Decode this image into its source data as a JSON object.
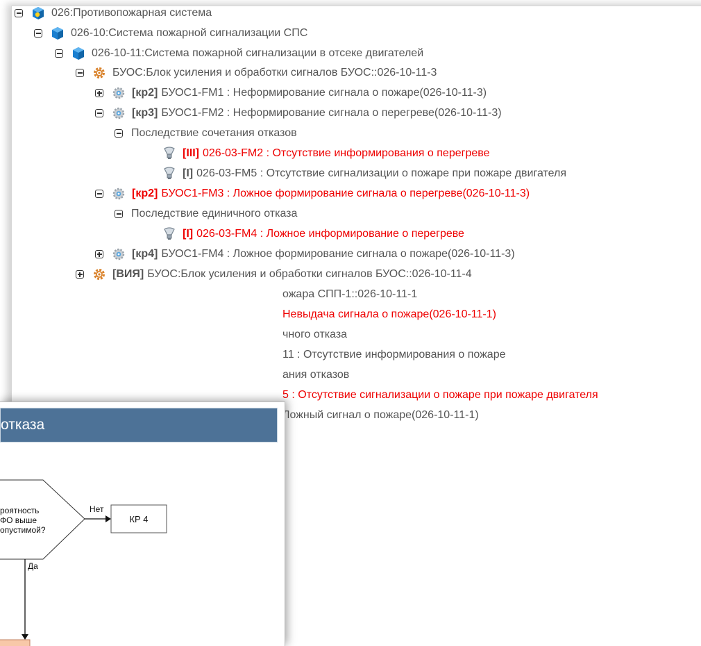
{
  "tree": {
    "rows": [
      {
        "toggle": "minus",
        "icon": "cube-yellow-icon",
        "text": "026:Противопожарная система",
        "text_class": "gray"
      },
      {
        "toggle": "minus",
        "icon": "cube-blue-icon",
        "text": "026-10:Система пожарной сигнализации СПС",
        "text_class": "gray"
      },
      {
        "toggle": "minus",
        "icon": "cube-blue-icon",
        "text": "026-10-11:Система пожарной сигнализации в отсеке двигателей",
        "text_class": "gray"
      },
      {
        "toggle": "minus",
        "icon": "gear-orange-icon",
        "text": "БУОС:Блок усиления и обработки сигналов БУОС::026-10-11-3",
        "text_class": "gray"
      },
      {
        "toggle": "plus",
        "icon": "gear-gray-icon",
        "code": "[кр2]",
        "code_class": "gray",
        "text": "БУОС1-FM1 : Неформирование сигнала о пожаре(026-10-11-3)",
        "text_class": "gray"
      },
      {
        "toggle": "minus",
        "icon": "gear-gray-icon",
        "code": "[кр3]",
        "code_class": "gray",
        "text": "БУОС1-FM2 : Неформирование сигнала о перегреве(026-10-11-3)",
        "text_class": "gray"
      },
      {
        "toggle": "minus",
        "text": "Последствие сочетания отказов",
        "text_class": "gray"
      },
      {
        "icon": "bulb-icon",
        "code": "[III]",
        "code_class": "red",
        "text": "026-03-FM2 : Отсутствие информирования о перегреве",
        "text_class": "red"
      },
      {
        "icon": "bulb-icon",
        "code": "[I]",
        "code_class": "gray",
        "text": "026-03-FM5 : Отсутствие сигнализации о пожаре при пожаре двигателя",
        "text_class": "gray"
      },
      {
        "toggle": "minus",
        "icon": "gear-gray-icon",
        "code": "[кр2]",
        "code_class": "red",
        "text": "БУОС1-FM3 : Ложное формирование сигнала о перегреве(026-10-11-3)",
        "text_class": "red"
      },
      {
        "toggle": "minus",
        "text": "Последствие единичного отказа",
        "text_class": "gray"
      },
      {
        "icon": "bulb-icon",
        "code": "[I]",
        "code_class": "red",
        "text": "026-03-FM4 : Ложное информирование о перегреве",
        "text_class": "red"
      },
      {
        "toggle": "plus",
        "icon": "gear-gray-icon",
        "code": "[кр4]",
        "code_class": "gray",
        "text": "БУОС1-FM4 : Ложное формирование сигнала о пожаре(026-10-11-3)",
        "text_class": "gray"
      },
      {
        "toggle": "plus",
        "icon": "gear-orange-icon",
        "code": "[ВИЯ]",
        "code_class": "gray",
        "text": "БУОС:Блок усиления и обработки сигналов БУОС::026-10-11-4",
        "text_class": "gray"
      },
      {
        "text": "ожара СПП-1::026-10-11-1",
        "text_class": "gray"
      },
      {
        "text": "Невыдача сигнала о пожаре(026-10-11-1)",
        "text_class": "red"
      },
      {
        "text": "чного отказа",
        "text_class": "gray"
      },
      {
        "text": "11 : Отсутствие информирования о пожаре",
        "text_class": "gray"
      },
      {
        "text": "ания отказов",
        "text_class": "gray"
      },
      {
        "text": "5 : Отсутствие сигнализации о пожаре при пожаре двигателя",
        "text_class": "red"
      },
      {
        "text": "Ложный сигнал о пожаре(026-10-11-1)",
        "text_class": "gray"
      }
    ]
  },
  "dialog": {
    "title": "отказа",
    "flow": {
      "decision_lines": [
        "роятность",
        "ФО выше",
        "опустимой?"
      ],
      "no_label": "Нет",
      "yes_label": "Да",
      "box_label": "КР 4"
    }
  },
  "colors": {
    "header_blue": "#4d7297",
    "red": "#e00000",
    "gray_text": "#555555",
    "orange_box": "#f8c8a8"
  }
}
